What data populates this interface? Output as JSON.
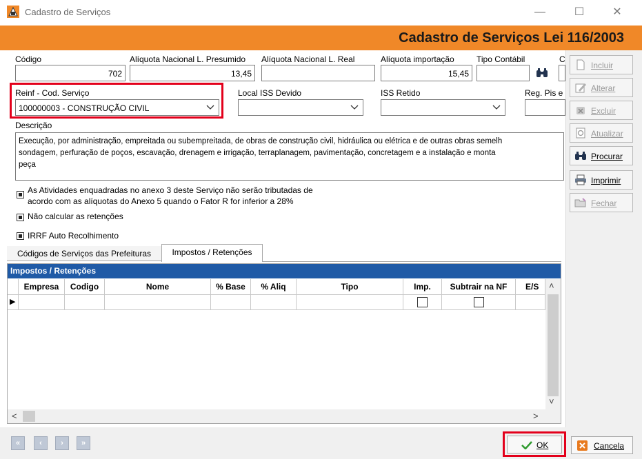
{
  "window": {
    "title": "Cadastro de Serviços",
    "minimize_glyph": "—",
    "maximize_glyph": "☐",
    "close_glyph": "✕"
  },
  "header": {
    "title": "Cadastro de Serviços Lei 116/2003"
  },
  "form": {
    "codigo": {
      "label": "Código",
      "value": "702"
    },
    "aliq_presumido": {
      "label": "Alíquota Nacional L. Presumido",
      "value": "13,45"
    },
    "aliq_real": {
      "label": "Alíquota Nacional L. Real",
      "value": ""
    },
    "aliq_importacao": {
      "label": "Alíquota importação",
      "value": "15,45"
    },
    "tipo_contabil": {
      "label": "Tipo Contábil",
      "value": ""
    },
    "extra_label_cut": "C",
    "reinf": {
      "label": "Reinf - Cod. Serviço",
      "value": "100000003 - CONSTRUÇÃO CIVIL"
    },
    "local_iss": {
      "label": "Local ISS Devido",
      "value": ""
    },
    "iss_retido": {
      "label": "ISS Retido",
      "value": ""
    },
    "reg_pis": {
      "label": "Reg. Pis e",
      "value": ""
    },
    "descricao": {
      "label": "Descrição",
      "lines": [
        "Execução, por administração, empreitada ou subempreitada, de obras de construção civil, hidráulica ou elétrica e de outras obras semelh",
        "sondagem, perfuração de poços, escavação, drenagem e irrigação, terraplanagem, pavimentação, concretagem e a instalação e monta",
        "peça"
      ]
    },
    "checks": {
      "anexo_line1": "As Atividades enquadradas no anexo 3 deste Serviço não serão tributadas de",
      "anexo_line2": "acordo com as alíquotas do Anexo 5 quando o Fator R for inferior a 28%",
      "nao_calcular": "Não calcular as retenções",
      "irrf": "IRRF Auto Recolhimento"
    }
  },
  "tabs": [
    {
      "label": "Códigos de Serviços das Prefeituras"
    },
    {
      "label": "Impostos / Retenções"
    }
  ],
  "grid": {
    "caption": "Impostos / Retenções",
    "columns": [
      "Empresa",
      "Codigo",
      "Nome",
      "% Base",
      "% Aliq",
      "Tipo",
      "Imp.",
      "Subtrair na NF",
      "E/S"
    ],
    "row_indicator": "▶",
    "scroll_up": "˄",
    "scroll_down": "˅",
    "scroll_left": "<",
    "scroll_right": ">"
  },
  "side_buttons": [
    {
      "label": "Incluir",
      "icon": "document-icon",
      "enabled": false
    },
    {
      "label": "Alterar",
      "icon": "pencil-icon",
      "enabled": false
    },
    {
      "label": "Excluir",
      "icon": "delete-icon",
      "enabled": false
    },
    {
      "label": "Atualizar",
      "icon": "refresh-icon",
      "enabled": false
    },
    {
      "label": "Procurar",
      "icon": "binoculars-icon",
      "enabled": true
    },
    {
      "label": "Imprimir",
      "icon": "printer-icon",
      "enabled": true
    },
    {
      "label": "Fechar",
      "icon": "folder-icon",
      "enabled": false
    }
  ],
  "bottom": {
    "nav": [
      "«",
      "‹",
      "›",
      "»"
    ],
    "ok_label": "OK",
    "cancel_label": "Cancela"
  },
  "colors": {
    "header_orange": "#f08828",
    "grid_caption_blue": "#1f5aa6",
    "highlight_red": "#e3001b"
  }
}
